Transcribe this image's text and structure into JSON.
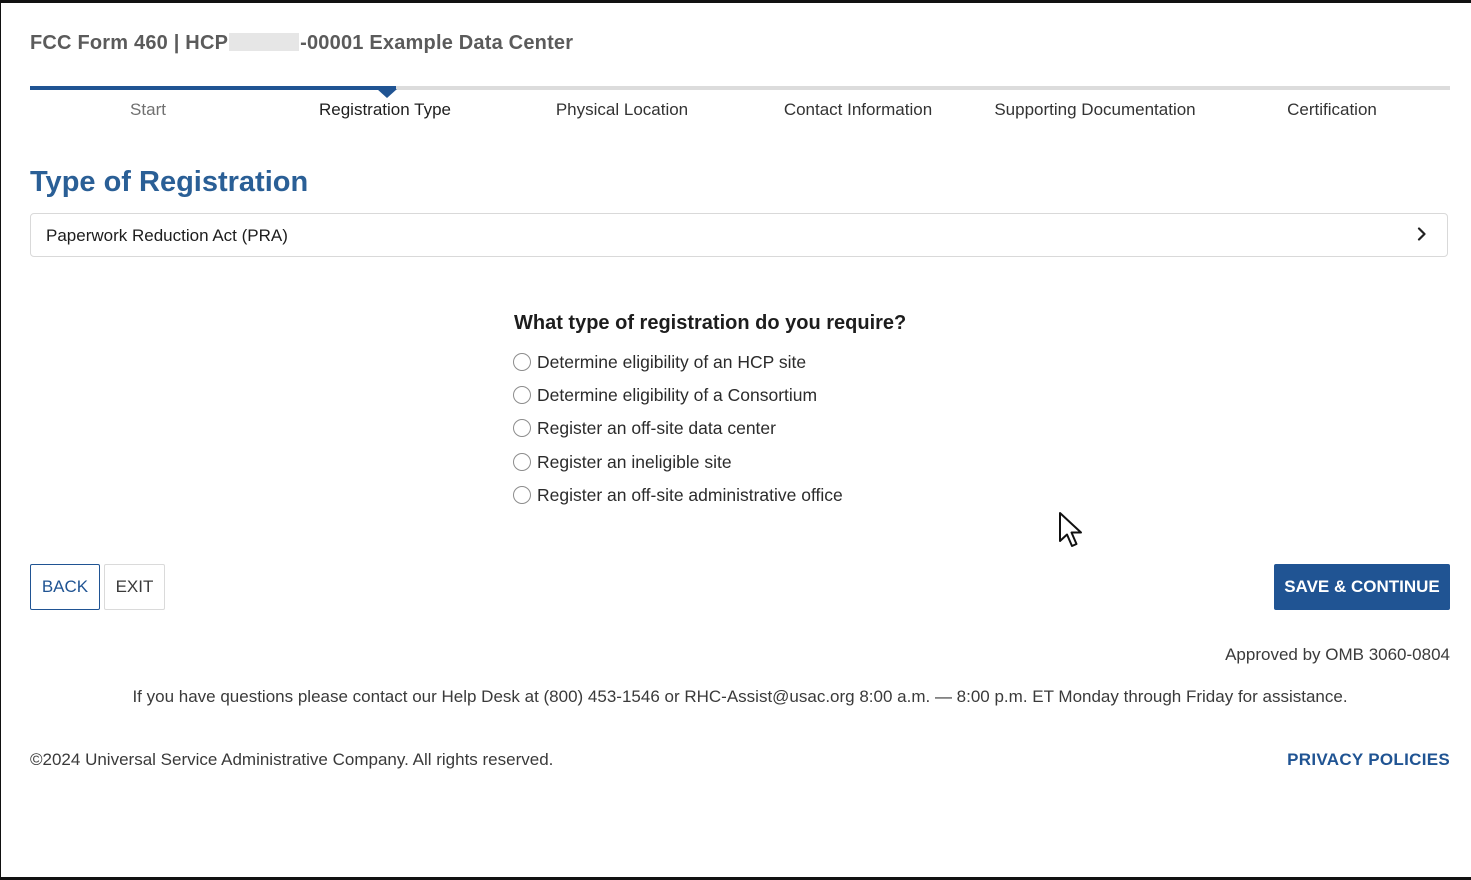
{
  "header": {
    "title_prefix": "FCC Form 460 | HCP",
    "title_suffix": "-00001 Example Data Center"
  },
  "progress": {
    "fraction_complete": 0.25,
    "steps": [
      {
        "label": "Start",
        "state": "completed"
      },
      {
        "label": "Registration Type",
        "state": "active"
      },
      {
        "label": "Physical Location",
        "state": "upcoming"
      },
      {
        "label": "Contact Information",
        "state": "upcoming"
      },
      {
        "label": "Supporting Documentation",
        "state": "upcoming"
      },
      {
        "label": "Certification",
        "state": "upcoming"
      }
    ]
  },
  "main": {
    "section_title": "Type of Registration",
    "accordion_label": "Paperwork Reduction Act (PRA)",
    "question": "What type of registration do you require?",
    "options": [
      {
        "label": "Determine eligibility of an HCP site",
        "selected": false
      },
      {
        "label": "Determine eligibility of a Consortium",
        "selected": false
      },
      {
        "label": "Register an off-site data center",
        "selected": false
      },
      {
        "label": "Register an ineligible site",
        "selected": false
      },
      {
        "label": "Register an off-site administrative office",
        "selected": false
      }
    ]
  },
  "actions": {
    "back_label": "BACK",
    "exit_label": "EXIT",
    "save_label": "SAVE & CONTINUE"
  },
  "footer": {
    "omb": "Approved by OMB 3060-0804",
    "help_text": "If you have questions please contact our Help Desk at (800) 453-1546 or RHC-Assist@usac.org 8:00 a.m. — 8:00 p.m. ET Monday through Friday for assistance.",
    "copyright": "©2024 Universal Service Administrative Company. All rights reserved.",
    "privacy_label": "PRIVACY POLICIES"
  },
  "colors": {
    "primary": "#205493",
    "heading": "#2a5f96",
    "track": "#dcdcdc"
  },
  "icons": {
    "accordion": "chevron-right-icon",
    "cursor": "mouse-pointer-icon"
  }
}
